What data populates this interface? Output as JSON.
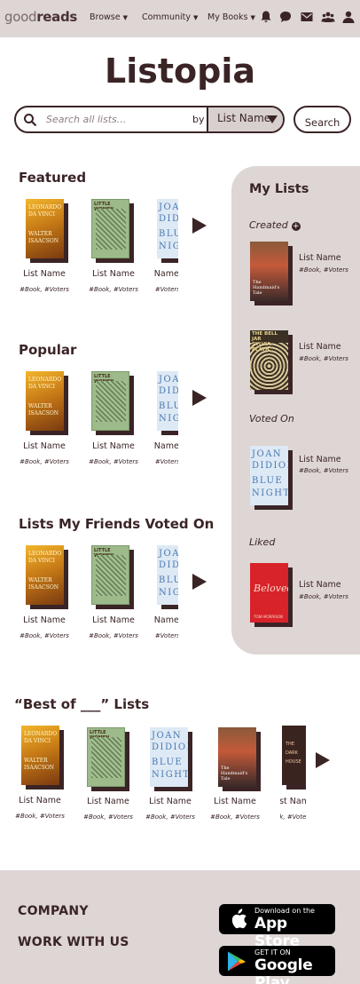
{
  "nav": {
    "logo_light": "good",
    "logo_bold": "reads",
    "links": [
      {
        "label": "Browse"
      },
      {
        "label": "Community"
      },
      {
        "label": "My Books"
      }
    ],
    "icons": [
      "bell-icon",
      "chat-icon",
      "mail-icon",
      "friends-icon",
      "profile-icon"
    ]
  },
  "page": {
    "title": "Listopia"
  },
  "search": {
    "placeholder": "Search all lists...",
    "by_label": "by",
    "filter_value": "List Name",
    "button_label": "Search"
  },
  "sections": {
    "featured": "Featured",
    "popular": "Popular",
    "friends": "Lists My Friends Voted On",
    "bestof": "“Best of ___” Lists"
  },
  "list_card": {
    "name": "List Name",
    "meta": "#Book, #Voters"
  },
  "covers": {
    "leonardo": [
      "LEONARDO",
      "DA VINCI",
      "WALTER",
      "ISAACSON"
    ],
    "little_women": {
      "title": "LITTLE WOMEN",
      "author": "LOUISA M. ALCOTT"
    },
    "joan_didion": [
      "JOAN",
      "DIDION",
      "BLUE",
      "NIGHTS"
    ],
    "handmaid": "The Handmaid's Tale",
    "bell_jar": [
      "THE BELL JAR",
      "SYLVIA PLATH"
    ],
    "beloved": {
      "title": "Beloved",
      "author": "TONI MORRISON"
    },
    "dark": [
      "THE",
      "DARK",
      "HOUSE"
    ]
  },
  "my_lists": {
    "title": "My Lists",
    "created": "Created",
    "voted_on": "Voted On",
    "liked": "Liked",
    "item_name": "List Name",
    "item_meta": "#Book, #Voters"
  },
  "footer": {
    "company": "COMPANY",
    "work": "WORK WITH US",
    "appstore_small": "Download on the",
    "appstore_big": "App Store",
    "gplay_small": "GET IT ON",
    "gplay_big": "Google Play"
  }
}
